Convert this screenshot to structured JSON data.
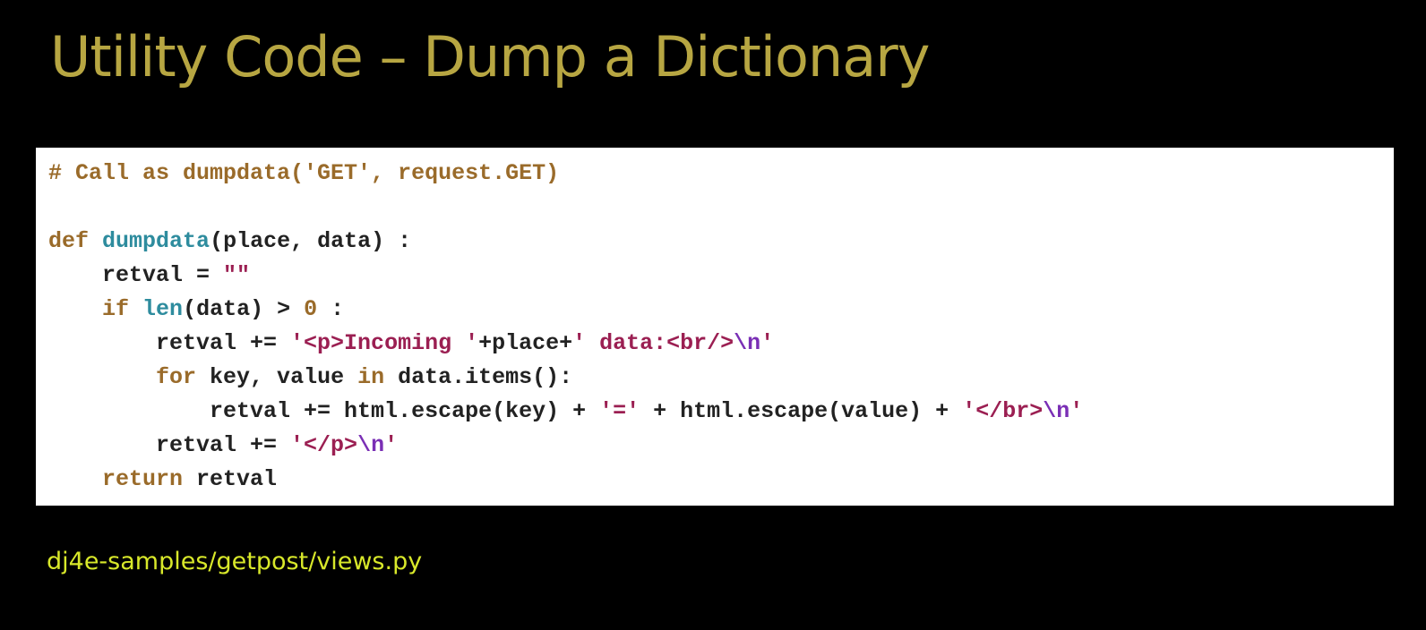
{
  "slide": {
    "title": "Utility Code – Dump a Dictionary",
    "footer_path": "dj4e-samples/getpost/views.py"
  },
  "code": {
    "lines": [
      [
        {
          "t": "comment",
          "v": "# Call as dumpdata('GET', request.GET)"
        }
      ],
      [],
      [
        {
          "t": "kw",
          "v": "def"
        },
        {
          "t": "plain",
          "v": " "
        },
        {
          "t": "fn",
          "v": "dumpdata"
        },
        {
          "t": "plain",
          "v": "(place, data) :"
        }
      ],
      [
        {
          "t": "plain",
          "v": "    retval = "
        },
        {
          "t": "str",
          "v": "\"\""
        }
      ],
      [
        {
          "t": "plain",
          "v": "    "
        },
        {
          "t": "kw",
          "v": "if"
        },
        {
          "t": "plain",
          "v": " "
        },
        {
          "t": "builtin",
          "v": "len"
        },
        {
          "t": "plain",
          "v": "(data) > "
        },
        {
          "t": "num",
          "v": "0"
        },
        {
          "t": "plain",
          "v": " :"
        }
      ],
      [
        {
          "t": "plain",
          "v": "        retval += "
        },
        {
          "t": "str",
          "v": "'<p>Incoming '"
        },
        {
          "t": "plain",
          "v": "+place+"
        },
        {
          "t": "str",
          "v": "' data:<br/>"
        },
        {
          "t": "esc",
          "v": "\\n"
        },
        {
          "t": "str",
          "v": "'"
        }
      ],
      [
        {
          "t": "plain",
          "v": "        "
        },
        {
          "t": "kw",
          "v": "for"
        },
        {
          "t": "plain",
          "v": " key, value "
        },
        {
          "t": "kw",
          "v": "in"
        },
        {
          "t": "plain",
          "v": " data.items():"
        }
      ],
      [
        {
          "t": "plain",
          "v": "            retval += html.escape(key) + "
        },
        {
          "t": "str",
          "v": "'='"
        },
        {
          "t": "plain",
          "v": " + html.escape(value) + "
        },
        {
          "t": "str",
          "v": "'</br>"
        },
        {
          "t": "esc",
          "v": "\\n"
        },
        {
          "t": "str",
          "v": "'"
        }
      ],
      [
        {
          "t": "plain",
          "v": "        retval += "
        },
        {
          "t": "str",
          "v": "'</p>"
        },
        {
          "t": "esc",
          "v": "\\n"
        },
        {
          "t": "str",
          "v": "'"
        }
      ],
      [
        {
          "t": "plain",
          "v": "    "
        },
        {
          "t": "kw",
          "v": "return"
        },
        {
          "t": "plain",
          "v": " retval"
        }
      ]
    ]
  },
  "colors": {
    "background": "#000000",
    "title": "#b7a642",
    "footer": "#d8e82a",
    "code_background": "#ffffff",
    "keyword": "#9a6b2a",
    "function": "#2e8c9e",
    "string": "#9b1f52",
    "escape": "#7a2fb5"
  }
}
